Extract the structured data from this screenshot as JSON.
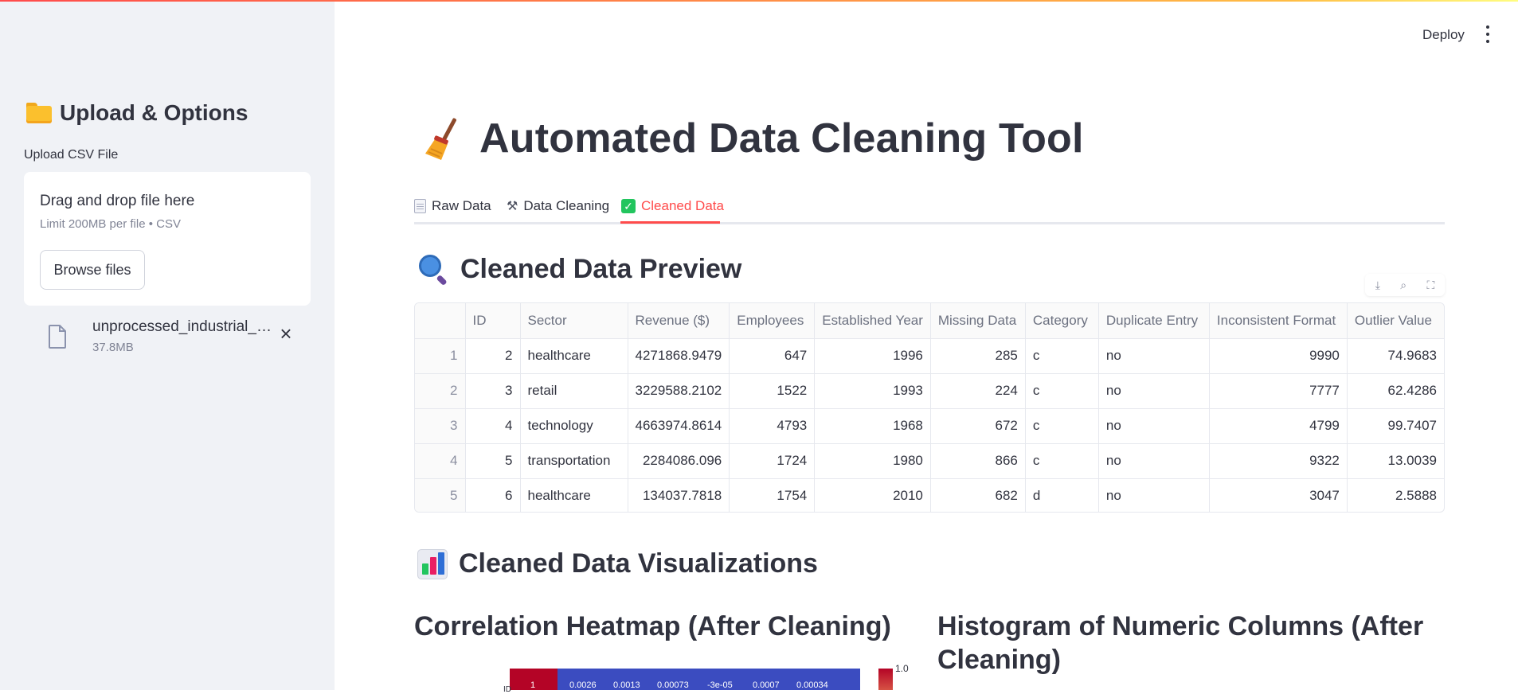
{
  "header": {
    "deploy_label": "Deploy",
    "menu_icon": "kebab-menu-icon"
  },
  "sidebar": {
    "title": "Upload & Options",
    "title_icon": "folder-icon",
    "upload_label": "Upload CSV File",
    "dropzone": {
      "main_text": "Drag and drop file here",
      "sub_text": "Limit 200MB per file • CSV",
      "browse_label": "Browse files"
    },
    "file": {
      "name": "unprocessed_industrial_…",
      "size": "37.8MB"
    }
  },
  "main": {
    "title": "Automated Data Cleaning Tool",
    "title_icon": "broom-icon",
    "tabs": [
      {
        "label": "Raw Data",
        "icon": "document-icon",
        "active": false
      },
      {
        "label": "Data Cleaning",
        "icon": "tools-icon",
        "active": false
      },
      {
        "label": "Cleaned Data",
        "icon": "check-icon",
        "active": true
      }
    ],
    "preview_title": "Cleaned Data Preview",
    "table": {
      "columns": [
        "",
        "ID",
        "Sector",
        "Revenue ($)",
        "Employees",
        "Established Year",
        "Missing Data",
        "Category",
        "Duplicate Entry",
        "Inconsistent Format",
        "Outlier Value"
      ],
      "rows": [
        [
          "1",
          "2",
          "healthcare",
          "4271868.9479",
          "647",
          "1996",
          "285",
          "c",
          "no",
          "9990",
          "74.9683"
        ],
        [
          "2",
          "3",
          "retail",
          "3229588.2102",
          "1522",
          "1993",
          "224",
          "c",
          "no",
          "7777",
          "62.4286"
        ],
        [
          "3",
          "4",
          "technology",
          "4663974.8614",
          "4793",
          "1968",
          "672",
          "c",
          "no",
          "4799",
          "99.7407"
        ],
        [
          "4",
          "5",
          "transportation",
          "2284086.096",
          "1724",
          "1980",
          "866",
          "c",
          "no",
          "9322",
          "13.0039"
        ],
        [
          "5",
          "6",
          "healthcare",
          "134037.7818",
          "1754",
          "2010",
          "682",
          "d",
          "no",
          "3047",
          "2.5888"
        ]
      ]
    },
    "viz_title": "Cleaned Data Visualizations",
    "heatmap_title": "Correlation Heatmap (After Cleaning)",
    "histogram_title": "Histogram of Numeric Columns (After Cleaning)",
    "heatmap": {
      "row_label": "ID",
      "cells": [
        "1",
        "0.0026",
        "0.0013",
        "0.00073",
        "-3e-05",
        "0.0007",
        "0.00034"
      ],
      "colorbar_tick": "1.0",
      "colors": {
        "high": "#b40426",
        "low": "#3b4cc0"
      }
    }
  }
}
